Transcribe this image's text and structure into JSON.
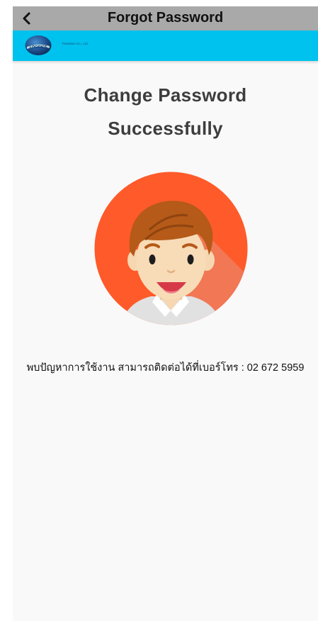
{
  "header": {
    "title": "Forgot Password",
    "back_icon": "chevron-left-icon"
  },
  "banner": {
    "logo_icon": "globe-logo-icon",
    "logo_text": "LOGIDICS",
    "company": "Transition Co., Ltd.",
    "background": "#00c2ee"
  },
  "main": {
    "heading_line1": "Change Password",
    "heading_line2": "Successfully",
    "avatar_icon": "user-avatar-icon",
    "contact_text": "พบปัญหาการใช้งาน สามารถติดต่อได้ที่เบอร์โทร : 02 672 5959"
  },
  "colors": {
    "titlebar": "#a9a9a9",
    "accent": "#00c2ee",
    "avatar_bg": "#ff5a2a",
    "heading": "#3d3d3d",
    "page_bg": "#f9f9f9"
  }
}
